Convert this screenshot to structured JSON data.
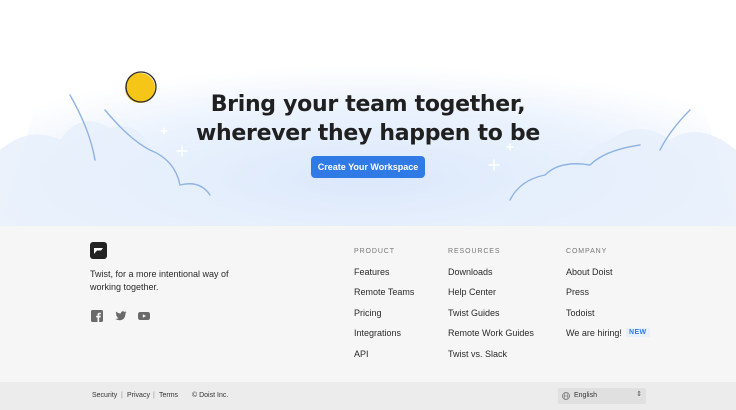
{
  "hero": {
    "title_line1": "Bring your team together,",
    "title_line2": "wherever they happen to be",
    "cta_label": "Create Your Workspace"
  },
  "footer": {
    "tagline": "Twist, for a more intentional way of working together.",
    "columns": [
      {
        "heading": "PRODUCT",
        "links": [
          "Features",
          "Remote Teams",
          "Pricing",
          "Integrations",
          "API"
        ]
      },
      {
        "heading": "RESOURCES",
        "links": [
          "Downloads",
          "Help Center",
          "Twist Guides",
          "Remote Work Guides",
          "Twist vs. Slack"
        ]
      },
      {
        "heading": "COMPANY",
        "links": [
          "About Doist",
          "Press",
          "Todoist",
          "We are hiring!"
        ]
      }
    ],
    "new_badge": "NEW",
    "social": [
      "facebook-icon",
      "twitter-icon",
      "youtube-icon"
    ]
  },
  "bottom": {
    "links": [
      "Security",
      "Privacy",
      "Terms"
    ],
    "copyright": "© Doist Inc.",
    "language": "English"
  },
  "colors": {
    "accent": "#2f7ae5",
    "footer_bg": "#f6f6f6",
    "bottom_bg": "#ececec",
    "sun": "#f5c518"
  }
}
